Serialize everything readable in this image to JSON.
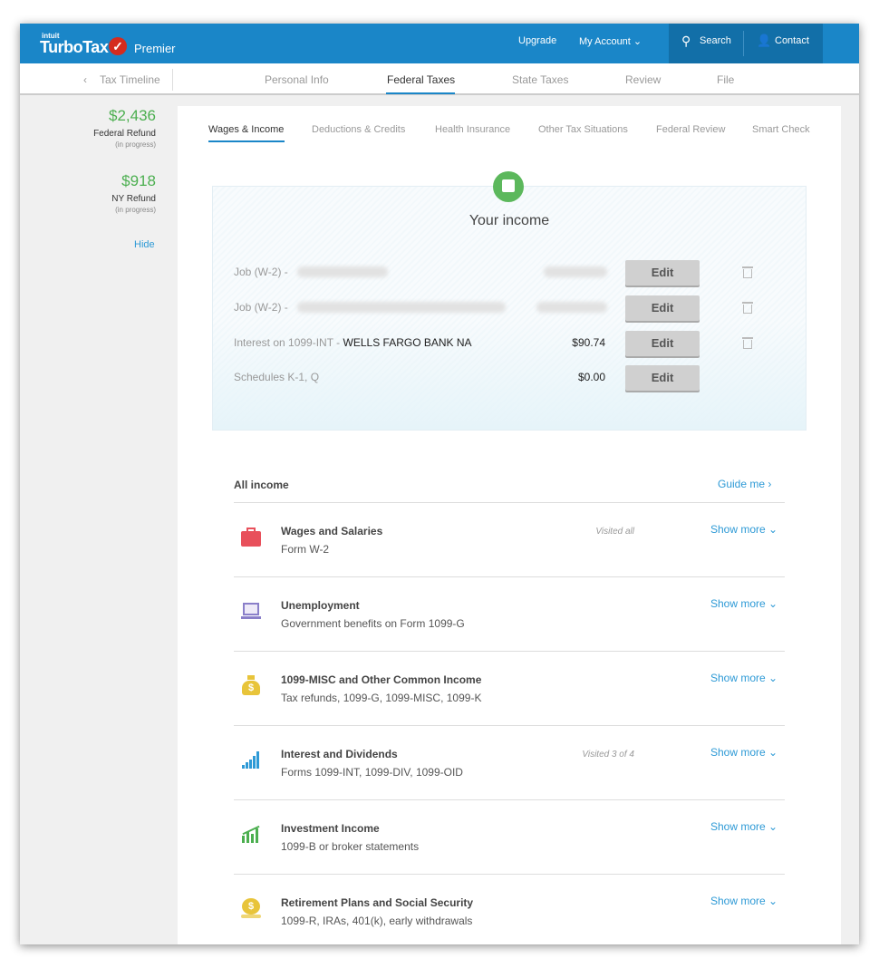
{
  "header": {
    "brand_small": "intuit",
    "brand": "TurboTax",
    "product": "Premier",
    "upgrade": "Upgrade",
    "my_account": "My Account ⌄",
    "search": "Search",
    "contact": "Contact"
  },
  "nav": {
    "back": "Tax Timeline",
    "tabs": [
      "Personal Info",
      "Federal Taxes",
      "State Taxes",
      "Review",
      "File"
    ],
    "active": "Federal Taxes"
  },
  "sidebar": {
    "federal_amount": "$2,436",
    "federal_label": "Federal Refund",
    "federal_status": "(in progress)",
    "state_amount": "$918",
    "state_label": "NY Refund",
    "state_status": "(in progress)",
    "hide": "Hide"
  },
  "subtabs": [
    "Wages & Income",
    "Deductions & Credits",
    "Health Insurance",
    "Other Tax Situations",
    "Federal Review",
    "Smart Check"
  ],
  "income": {
    "title": "Your income",
    "rows": [
      {
        "label": "Job (W-2) -",
        "name": "",
        "amount": "",
        "edit": "Edit"
      },
      {
        "label": "Job (W-2) -",
        "name": "",
        "amount": "",
        "edit": "Edit"
      },
      {
        "label": "Interest on 1099-INT -",
        "name": "WELLS FARGO BANK NA",
        "amount": "$90.74",
        "edit": "Edit"
      },
      {
        "label": "Schedules K-1, Q",
        "name": "",
        "amount": "$0.00",
        "edit": "Edit"
      }
    ]
  },
  "all_income": {
    "title": "All income",
    "guide": "Guide me ›",
    "items": [
      {
        "title": "Wages and Salaries",
        "sub": "Form W-2",
        "visited": "Visited all",
        "more": "Show more ⌄",
        "icon": "briefcase-icon",
        "color": "#e8505b"
      },
      {
        "title": "Unemployment",
        "sub": "Government benefits on Form 1099-G",
        "visited": "",
        "more": "Show more ⌄",
        "icon": "laptop-search-icon",
        "color": "#8a7fc9"
      },
      {
        "title": "1099-MISC and Other Common Income",
        "sub": "Tax refunds, 1099-G, 1099-MISC, 1099-K",
        "visited": "",
        "more": "Show more ⌄",
        "icon": "money-bag-icon",
        "color": "#e8c43a"
      },
      {
        "title": "Interest and Dividends",
        "sub": "Forms 1099-INT, 1099-DIV, 1099-OID",
        "visited": "Visited 3 of 4",
        "more": "Show more ⌄",
        "icon": "bar-chart-icon",
        "color": "#2e9ad6"
      },
      {
        "title": "Investment Income",
        "sub": "1099-B or broker statements",
        "visited": "",
        "more": "Show more ⌄",
        "icon": "growth-chart-icon",
        "color": "#4caf50"
      },
      {
        "title": "Retirement Plans and Social Security",
        "sub": "1099-R, IRAs, 401(k), early withdrawals",
        "visited": "",
        "more": "Show more ⌄",
        "icon": "coin-stack-icon",
        "color": "#e8c43a"
      }
    ]
  }
}
